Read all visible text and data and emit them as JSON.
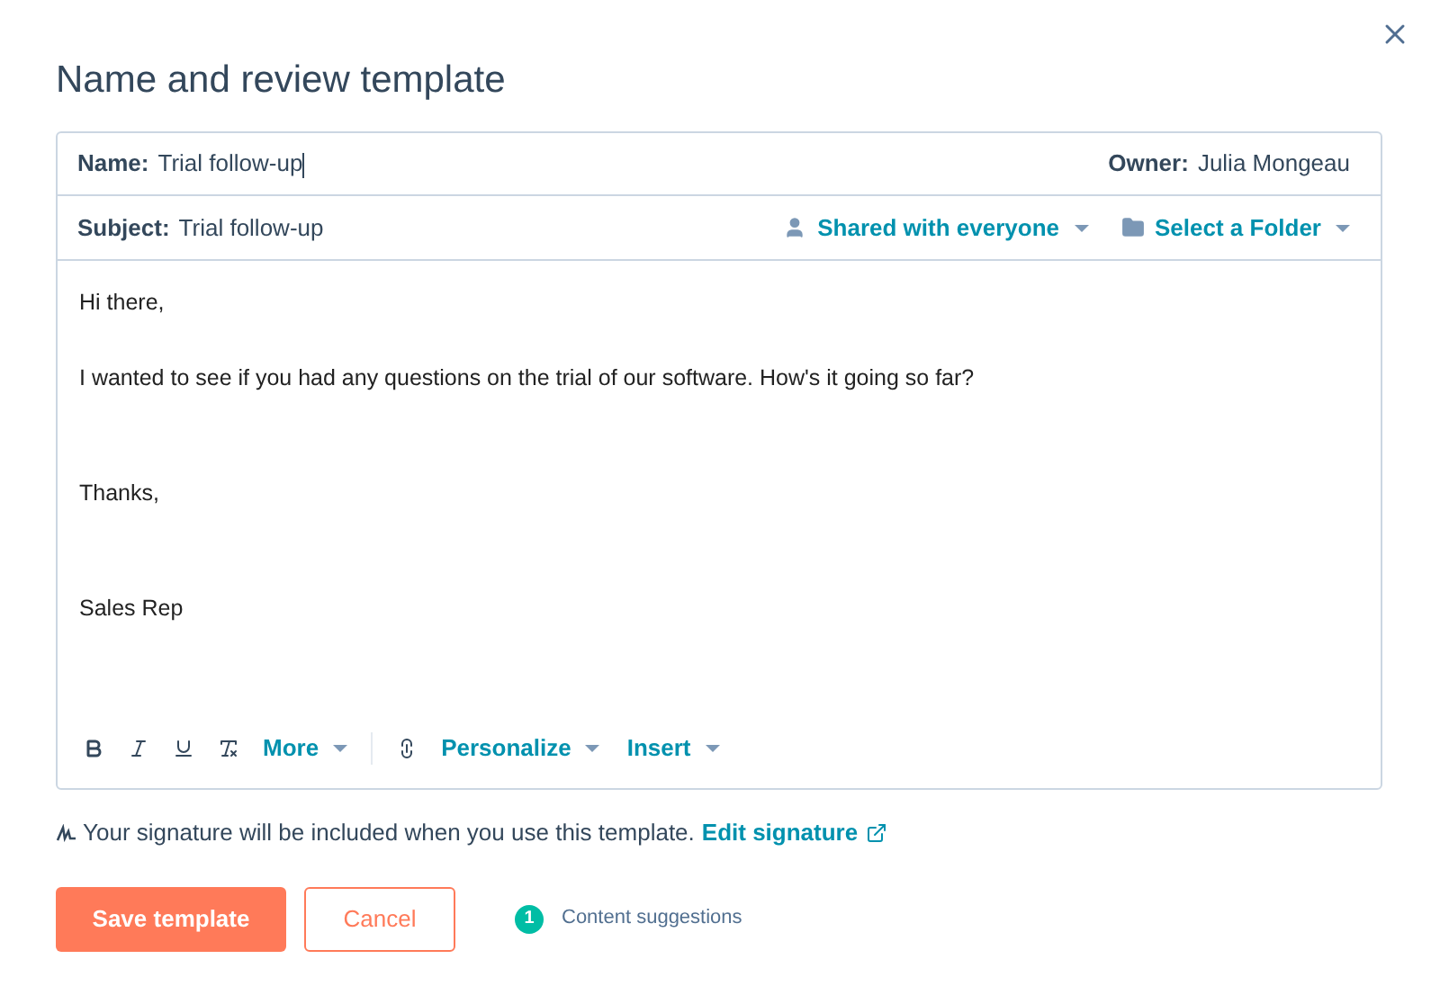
{
  "dialog": {
    "title": "Name and review template"
  },
  "name": {
    "label": "Name:",
    "value": "Trial follow-up"
  },
  "owner": {
    "label": "Owner:",
    "value": "Julia Mongeau"
  },
  "subject": {
    "label": "Subject:",
    "value": "Trial follow-up"
  },
  "sharing": {
    "label": "Shared with everyone"
  },
  "folder": {
    "label": "Select a Folder"
  },
  "body": [
    "Hi there,",
    "I wanted to see if you had any questions on the trial of our software. How's it going so far?",
    "Thanks,",
    "Sales Rep"
  ],
  "toolbar": {
    "more": "More",
    "personalize": "Personalize",
    "insert": "Insert"
  },
  "signature": {
    "text": "Your signature will be included when you use this template.",
    "link": "Edit signature"
  },
  "buttons": {
    "save": "Save template",
    "cancel": "Cancel"
  },
  "suggestions": {
    "count": "1",
    "label": "Content suggestions"
  }
}
